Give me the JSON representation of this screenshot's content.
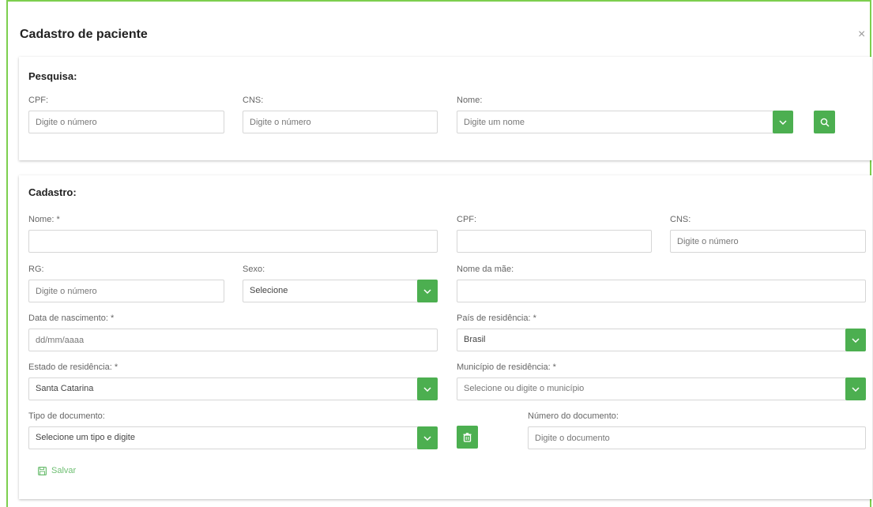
{
  "modal": {
    "title": "Cadastro de paciente",
    "close_label": "×"
  },
  "search": {
    "section_title": "Pesquisa:",
    "cpf_label": "CPF:",
    "cpf_placeholder": "Digite o número",
    "cns_label": "CNS:",
    "cns_placeholder": "Digite o número",
    "nome_label": "Nome:",
    "nome_placeholder": "Digite um nome"
  },
  "form": {
    "section_title": "Cadastro:",
    "nome_label": "Nome: *",
    "nome_value": "",
    "cpf_label": "CPF:",
    "cpf_value": "",
    "cns_label": "CNS:",
    "cns_placeholder": "Digite o número",
    "rg_label": "RG:",
    "rg_placeholder": "Digite o número",
    "sexo_label": "Sexo:",
    "sexo_value": "Selecione",
    "mae_label": "Nome da mãe:",
    "mae_value": "",
    "nascimento_label": "Data de nascimento: *",
    "nascimento_placeholder": "dd/mm/aaaa",
    "pais_label": "País de residência: *",
    "pais_value": "Brasil",
    "estado_label": "Estado de residência: *",
    "estado_value": "Santa Catarina",
    "municipio_label": "Município de residência: *",
    "municipio_value": "Selecione ou digite o município",
    "tipo_doc_label": "Tipo de documento:",
    "tipo_doc_value": "Selecione um tipo e digite",
    "num_doc_label": "Número do documento:",
    "num_doc_placeholder": "Digite o documento",
    "save_label": "Salvar"
  },
  "colors": {
    "accent": "#4caf50",
    "frame_border": "#7dcf4e"
  },
  "icons": {
    "dropdown": "chevron-down-icon",
    "search": "search-icon",
    "delete": "trash-icon",
    "save": "floppy-disk-icon",
    "close": "close-icon"
  }
}
